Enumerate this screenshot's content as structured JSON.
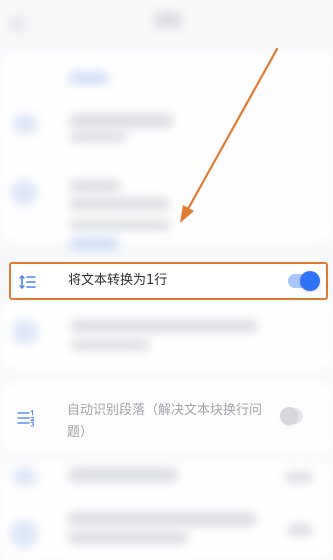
{
  "settings": {
    "merge_lines_label": "将文本转换为1行",
    "merge_lines_enabled": true,
    "auto_paragraph_label": "自动识别段落（解决文本块换行问题）",
    "auto_paragraph_enabled": false
  },
  "colors": {
    "highlight_border": "#e07a2f",
    "toggle_on": "#2f72f6",
    "toggle_on_track": "#a8c6fb",
    "toggle_off": "#d5d7dc",
    "icon_blue": "#4b84ec"
  },
  "icons": {
    "merge_lines": "line-spacing-icon",
    "auto_paragraph": "numbered-list-icon"
  }
}
